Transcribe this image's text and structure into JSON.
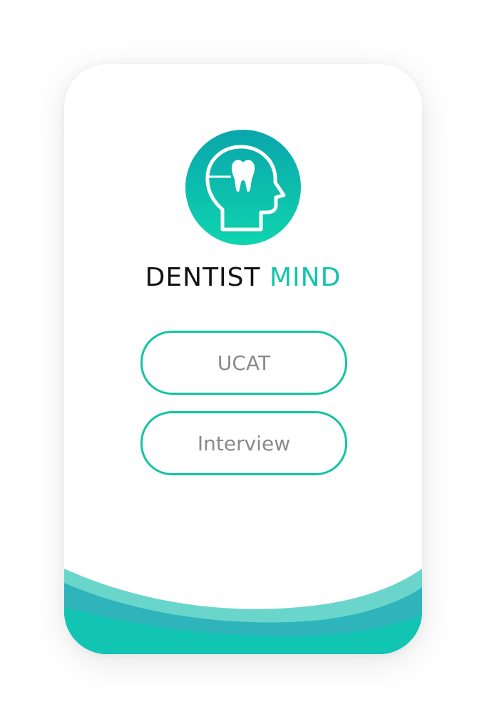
{
  "app": {
    "brand_primary": "DENTIST",
    "brand_accent": "MIND",
    "accent_color": "#12c4ad"
  },
  "logo": {
    "icon": "head-with-tooth-icon"
  },
  "menu": {
    "ucat_label": "UCAT",
    "interview_label": "Interview"
  }
}
